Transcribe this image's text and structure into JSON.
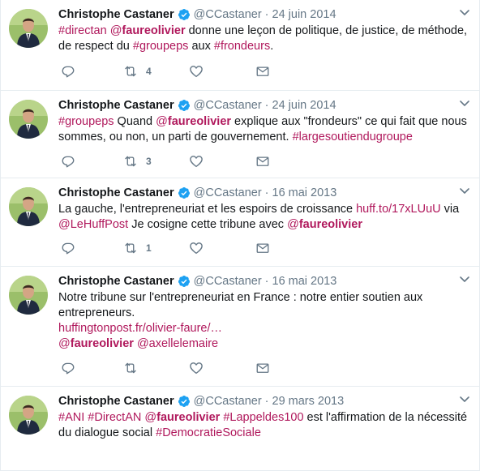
{
  "colors": {
    "accent": "#b0185c",
    "muted": "#657786",
    "verified": "#1da1f2",
    "border": "#e6ecf0"
  },
  "icons": {
    "reply": "reply-icon",
    "retweet": "retweet-icon",
    "like": "heart-icon",
    "dm": "envelope-icon",
    "verified": "verified-badge-icon",
    "caret": "chevron-down-icon"
  },
  "tweets": [
    {
      "name": "Christophe Castaner",
      "handle": "@CCastaner",
      "sep": "·",
      "date": "24 juin 2014",
      "segments": [
        {
          "t": "hash",
          "v": "#directan"
        },
        {
          "t": "plain",
          "v": " "
        },
        {
          "t": "mention",
          "at": "@",
          "v": "faureolivier"
        },
        {
          "t": "plain",
          "v": " donne une leçon de politique, de justice, de méthode, de respect du "
        },
        {
          "t": "hash",
          "v": "#groupeps"
        },
        {
          "t": "plain",
          "v": " aux "
        },
        {
          "t": "hash",
          "v": "#frondeurs"
        },
        {
          "t": "plain",
          "v": "."
        }
      ],
      "retweets": "4"
    },
    {
      "name": "Christophe Castaner",
      "handle": "@CCastaner",
      "sep": "·",
      "date": "24 juin 2014",
      "segments": [
        {
          "t": "hash",
          "v": "#groupeps"
        },
        {
          "t": "plain",
          "v": " Quand "
        },
        {
          "t": "mention",
          "at": "@",
          "v": "faureolivier"
        },
        {
          "t": "plain",
          "v": " explique aux \"frondeurs\" ce qui fait que nous sommes, ou non, un parti de gouvernement. "
        },
        {
          "t": "hash",
          "v": "#largesoutiendugroupe"
        }
      ],
      "retweets": "3"
    },
    {
      "name": "Christophe Castaner",
      "handle": "@CCastaner",
      "sep": "·",
      "date": "16 mai 2013",
      "segments": [
        {
          "t": "plain",
          "v": "La gauche, l'entrepreneuriat et les espoirs de croissance "
        },
        {
          "t": "link",
          "v": "huff.to/17xLUuU"
        },
        {
          "t": "plain",
          "v": " via "
        },
        {
          "t": "link",
          "v": "@LeHuffPost"
        },
        {
          "t": "plain",
          "v": " Je cosigne cette tribune avec "
        },
        {
          "t": "mention",
          "at": "@",
          "v": "faureolivier"
        }
      ],
      "retweets": "1"
    },
    {
      "name": "Christophe Castaner",
      "handle": "@CCastaner",
      "sep": "·",
      "date": "16 mai 2013",
      "segments": [
        {
          "t": "plain",
          "v": "Notre tribune sur l'entrepreneuriat en France : notre entier soutien aux entrepreneurs."
        },
        {
          "t": "br",
          "v": ""
        },
        {
          "t": "link",
          "v": "huffingtonpost.fr/olivier-faure/…"
        },
        {
          "t": "br",
          "v": ""
        },
        {
          "t": "mention",
          "at": "@",
          "v": "faureolivier"
        },
        {
          "t": "plain",
          "v": " "
        },
        {
          "t": "link",
          "v": "@axellelemaire"
        }
      ],
      "retweets": ""
    },
    {
      "name": "Christophe Castaner",
      "handle": "@CCastaner",
      "sep": "·",
      "date": "29 mars 2013",
      "segments": [
        {
          "t": "hash",
          "v": "#ANI"
        },
        {
          "t": "plain",
          "v": " "
        },
        {
          "t": "hash",
          "v": "#DirectAN"
        },
        {
          "t": "plain",
          "v": " "
        },
        {
          "t": "mention",
          "at": "@",
          "v": "faureolivier"
        },
        {
          "t": "plain",
          "v": " "
        },
        {
          "t": "hash",
          "v": "#Lappeldes100"
        },
        {
          "t": "plain",
          "v": " est l'affirmation de la nécessité du dialogue social "
        },
        {
          "t": "hash",
          "v": "#DemocratieSociale"
        }
      ],
      "retweets": ""
    }
  ]
}
